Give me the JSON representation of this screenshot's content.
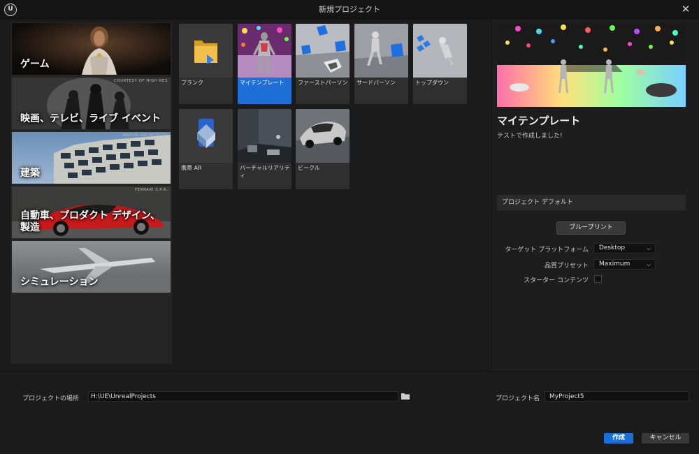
{
  "window": {
    "title": "新規プロジェクト",
    "close_glyph": "✕"
  },
  "categories": [
    {
      "label": "ゲーム",
      "selected": true
    },
    {
      "label": "映画、テレビ、ライブ イベント",
      "credit": "COURTESY OF HIGH RES",
      "selected": false
    },
    {
      "label": "建築",
      "credit": "MAPUR ARCHITECTS",
      "selected": false
    },
    {
      "label": "自動車、プロダクト デザイン、製造",
      "credit": "FERRARI S.P.A.",
      "selected": false
    },
    {
      "label": "シミュレーション",
      "selected": false
    }
  ],
  "templates": [
    {
      "name": "ブランク",
      "selected": false
    },
    {
      "name": "マイテンプレート",
      "selected": true
    },
    {
      "name": "ファーストパーソン",
      "selected": false
    },
    {
      "name": "サードパーソン",
      "selected": false
    },
    {
      "name": "トップダウン",
      "selected": false
    },
    {
      "name": "携帯 AR",
      "selected": false
    },
    {
      "name": "バーチャルリアリティ",
      "selected": false
    },
    {
      "name": "ビークル",
      "selected": false
    }
  ],
  "selected_template": {
    "title": "マイテンプレート",
    "description": "テストで作成しました!"
  },
  "defaults": {
    "header": "プロジェクト デフォルト",
    "blueprint_label": "ブループリント",
    "target_platform_label": "ターゲット プラットフォーム",
    "target_platform_value": "Desktop",
    "quality_label": "品質プリセット",
    "quality_value": "Maximum",
    "starter_label": "スターター コンテンツ",
    "starter_checked": false
  },
  "footer": {
    "location_label": "プロジェクトの場所",
    "location_value": "H:\\UE\\UnrealProjects",
    "name_label": "プロジェクト名",
    "name_value": "MyProject5",
    "create_label": "作成",
    "cancel_label": "キャンセル"
  },
  "colors": {
    "accent": "#1a6fd9",
    "panel": "#252525",
    "background": "#1b1b1b"
  }
}
